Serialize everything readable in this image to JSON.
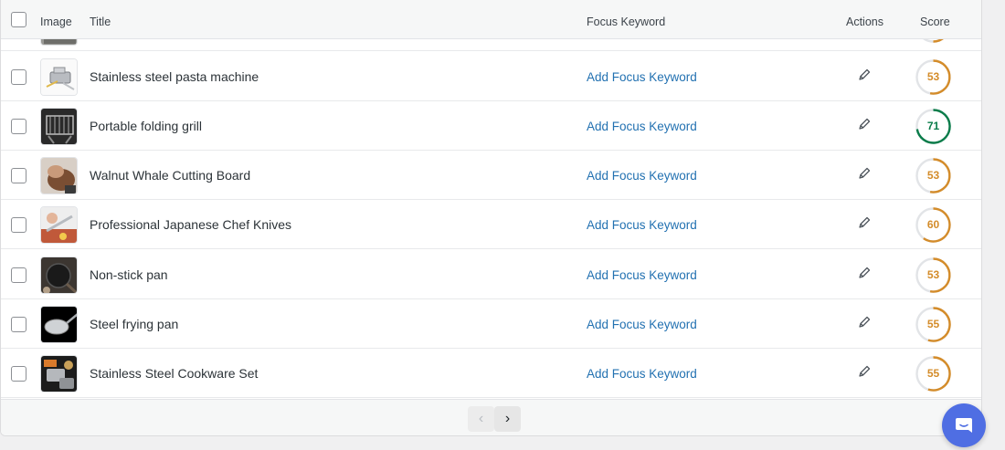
{
  "header": {
    "image_label": "Image",
    "title_label": "Title",
    "focus_keyword_label": "Focus Keyword",
    "actions_label": "Actions",
    "score_label": "Score"
  },
  "rows": [
    {
      "title": "Stainless steel pasta machine",
      "focus_keyword": "Add Focus Keyword",
      "score": "53",
      "score_color": "#d48c2a"
    },
    {
      "title": "Portable folding grill",
      "focus_keyword": "Add Focus Keyword",
      "score": "71",
      "score_color": "#0a7c4a"
    },
    {
      "title": "Walnut Whale Cutting Board",
      "focus_keyword": "Add Focus Keyword",
      "score": "53",
      "score_color": "#d48c2a"
    },
    {
      "title": "Professional Japanese Chef Knives",
      "focus_keyword": "Add Focus Keyword",
      "score": "60",
      "score_color": "#d48c2a"
    },
    {
      "title": "Non-stick pan",
      "focus_keyword": "Add Focus Keyword",
      "score": "53",
      "score_color": "#d48c2a"
    },
    {
      "title": "Steel frying pan",
      "focus_keyword": "Add Focus Keyword",
      "score": "55",
      "score_color": "#d48c2a"
    },
    {
      "title": "Stainless Steel Cookware Set",
      "focus_keyword": "Add Focus Keyword",
      "score": "55",
      "score_color": "#d48c2a"
    }
  ],
  "pagination": {
    "prev_icon": "chevron-left-icon",
    "prev_glyph": "‹",
    "next_icon": "chevron-right-icon",
    "next_glyph": "›"
  },
  "icons": {
    "edit": "pencil-icon",
    "chat": "chat-bubble-icon"
  },
  "colors": {
    "link": "#2271b1",
    "score_ok": "#d48c2a",
    "score_good": "#0a7c4a",
    "chat": "#4f6ee3"
  }
}
